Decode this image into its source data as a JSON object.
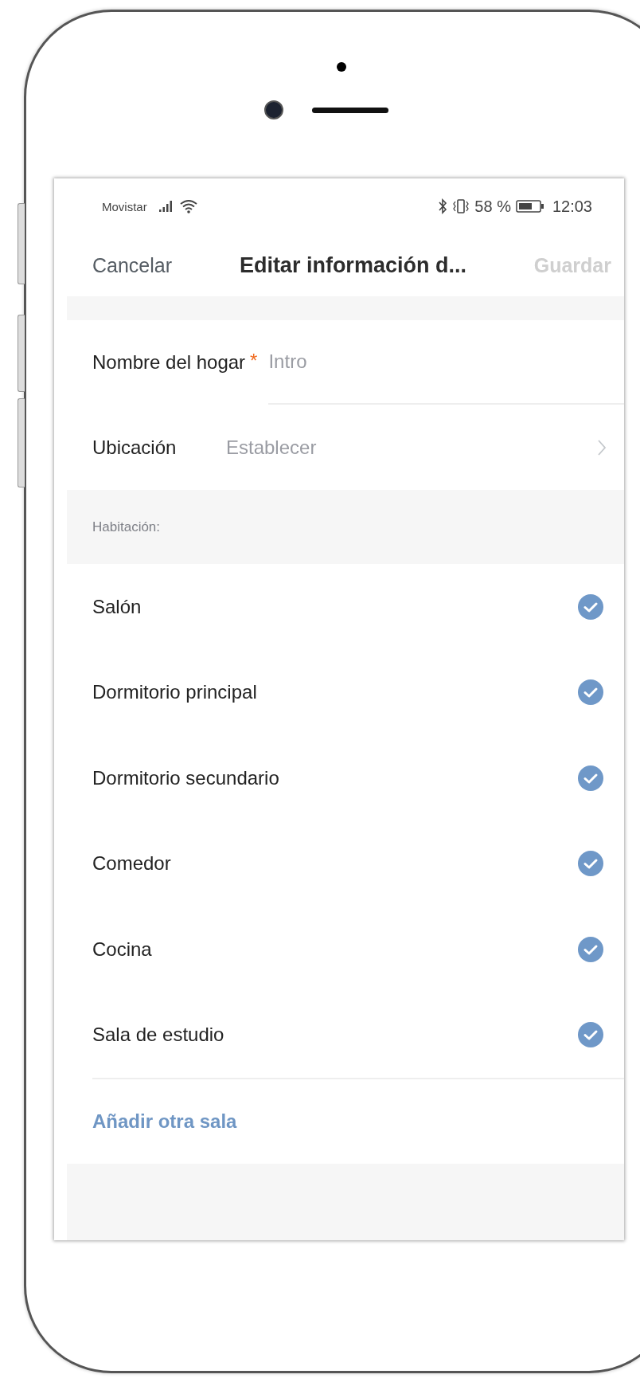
{
  "status_bar": {
    "carrier": "Movistar",
    "battery_percent": "58 %",
    "time": "12:03"
  },
  "header": {
    "cancel": "Cancelar",
    "title": "Editar información d...",
    "save": {
      "label": "Guardar",
      "disabled": true
    }
  },
  "home_name": {
    "label": "Nombre del hogar",
    "required": true,
    "required_mark": "*",
    "placeholder": "Intro"
  },
  "location": {
    "label": "Ubicación",
    "value": "Establecer"
  },
  "rooms_section": {
    "label": "Habitación:"
  },
  "rooms": [
    {
      "name": "Salón",
      "checked": true
    },
    {
      "name": "Dormitorio principal",
      "checked": true
    },
    {
      "name": "Dormitorio secundario",
      "checked": true
    },
    {
      "name": "Comedor",
      "checked": true
    },
    {
      "name": "Cocina",
      "checked": true
    },
    {
      "name": "Sala de estudio",
      "checked": true
    }
  ],
  "add_room_link": "Añadir otra sala"
}
